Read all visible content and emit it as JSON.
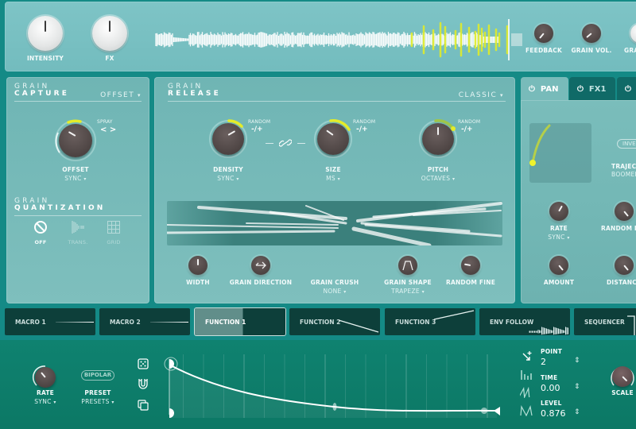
{
  "top": {
    "knobs": [
      {
        "name": "intensity",
        "label": "INTENSITY"
      },
      {
        "name": "fx",
        "label": "FX"
      },
      {
        "name": "feedback",
        "label": "FEEDBACK"
      },
      {
        "name": "grain-vol",
        "label": "GRAIN VOL."
      },
      {
        "name": "grain-partial",
        "label": "GRA"
      }
    ]
  },
  "capture": {
    "title_top": "GRAIN",
    "title_bottom": "CAPTURE",
    "mode": "OFFSET",
    "spray_label": "SPRAY",
    "spray_arrows": "< >",
    "knob_label": "OFFSET",
    "knob_sub": "SYNC"
  },
  "quantization": {
    "title_top": "GRAIN",
    "title_bottom": "QUANTIZATION",
    "options": [
      {
        "label": "OFF",
        "icon": "off-icon",
        "active": true
      },
      {
        "label": "TRANS.",
        "icon": "transient-icon",
        "active": false
      },
      {
        "label": "GRID",
        "icon": "grid-icon",
        "active": false
      }
    ]
  },
  "release": {
    "title_top": "GRAIN",
    "title_bottom": "RELEASE",
    "mode": "CLASSIC",
    "random_label": "RANDOM",
    "random_sign": "-/+",
    "knobs": [
      {
        "label": "DENSITY",
        "sub": "SYNC"
      },
      {
        "label": "SIZE",
        "sub": "MS"
      },
      {
        "label": "PITCH",
        "sub": "OCTAVES"
      }
    ],
    "small_knobs": [
      {
        "label": "WIDTH",
        "sub": ""
      },
      {
        "label": "GRAIN DIRECTION",
        "sub": ""
      },
      {
        "label": "GRAIN CRUSH",
        "sub": "NONE"
      },
      {
        "label": "GRAIN SHAPE",
        "sub": "TRAPEZE"
      },
      {
        "label": "RANDOM FINE",
        "sub": ""
      }
    ]
  },
  "fx_panel": {
    "tabs": [
      {
        "label": "PAN",
        "active": true
      },
      {
        "label": "FX1",
        "active": false
      },
      {
        "label": "",
        "active": false
      }
    ],
    "invert_label": "INVE",
    "trajectory_label": "TRAJEC",
    "trajectory_value": "BOOMER",
    "knobs": [
      {
        "label": "RATE",
        "sub": "SYNC"
      },
      {
        "label": "RANDOM P",
        "sub": ""
      },
      {
        "label": "AMOUNT",
        "sub": ""
      },
      {
        "label": "DISTANC",
        "sub": ""
      }
    ]
  },
  "modulators": [
    {
      "label": "MACRO 1",
      "selected": false
    },
    {
      "label": "MACRO 2",
      "selected": false
    },
    {
      "label": "FUNCTION 1",
      "selected": true
    },
    {
      "label": "FUNCTION 2",
      "selected": false
    },
    {
      "label": "FUNCTION 3",
      "selected": false
    },
    {
      "label": "ENV FOLLOW",
      "selected": false
    },
    {
      "label": "SEQUENCER",
      "selected": false
    }
  ],
  "function_editor": {
    "rate_label": "RATE",
    "rate_sub": "SYNC",
    "bipolar_label": "BIPOLAR",
    "preset_label": "PRESET",
    "preset_value": "PRESETS",
    "point_label": "POINT",
    "point_value": "2",
    "time_label": "TIME",
    "time_value": "0.00",
    "level_label": "LEVEL",
    "level_value": "0.876",
    "scale_label": "SCALE"
  },
  "colors": {
    "accent_yellow": "#e4ec2a",
    "panel": "#76bbba",
    "dark_tile": "#0d3f3a",
    "bottom_green": "#0e7f6c"
  }
}
